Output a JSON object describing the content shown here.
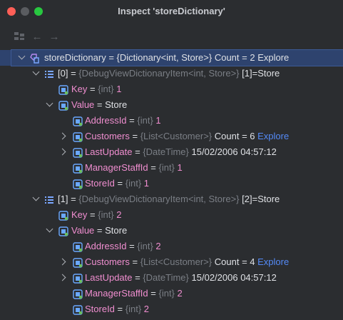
{
  "window": {
    "title": "Inspect 'storeDictionary'"
  },
  "root": {
    "name": "storeDictionary",
    "eq": " = ",
    "value": "{Dictionary<int, Store>} Count = 2",
    "explore": "Explore"
  },
  "items": [
    {
      "index": "[0]",
      "eq": " = ",
      "type": "{DebugViewDictionaryItem<int, Store>}",
      "suffix_key": "[1]",
      "suffix_val": "=Store",
      "key": {
        "name": "Key",
        "eq": " = ",
        "type": "{int}",
        "value": "1"
      },
      "value": {
        "name": "Value",
        "eq": " = ",
        "value": "Store"
      },
      "fields": {
        "address": {
          "name": "AddressId",
          "eq": " = ",
          "type": "{int}",
          "value": "1"
        },
        "customers": {
          "name": "Customers",
          "eq": " = ",
          "type": "{List<Customer>}",
          "value": "Count = 6",
          "explore": "Explore"
        },
        "lastupdate": {
          "name": "LastUpdate",
          "eq": " = ",
          "type": "{DateTime}",
          "value": "15/02/2006 04:57:12"
        },
        "manager": {
          "name": "ManagerStaffId",
          "eq": " = ",
          "type": "{int}",
          "value": "1"
        },
        "store": {
          "name": "StoreId",
          "eq": " = ",
          "type": "{int}",
          "value": "1"
        }
      }
    },
    {
      "index": "[1]",
      "eq": " = ",
      "type": "{DebugViewDictionaryItem<int, Store>}",
      "suffix_key": "[2]",
      "suffix_val": "=Store",
      "key": {
        "name": "Key",
        "eq": " = ",
        "type": "{int}",
        "value": "2"
      },
      "value": {
        "name": "Value",
        "eq": " = ",
        "value": "Store"
      },
      "fields": {
        "address": {
          "name": "AddressId",
          "eq": " = ",
          "type": "{int}",
          "value": "2"
        },
        "customers": {
          "name": "Customers",
          "eq": " = ",
          "type": "{List<Customer>}",
          "value": "Count = 4",
          "explore": "Explore"
        },
        "lastupdate": {
          "name": "LastUpdate",
          "eq": " = ",
          "type": "{DateTime}",
          "value": "15/02/2006 04:57:12"
        },
        "manager": {
          "name": "ManagerStaffId",
          "eq": " = ",
          "type": "{int}",
          "value": "2"
        },
        "store": {
          "name": "StoreId",
          "eq": " = ",
          "type": "{int}",
          "value": "2"
        }
      }
    }
  ]
}
